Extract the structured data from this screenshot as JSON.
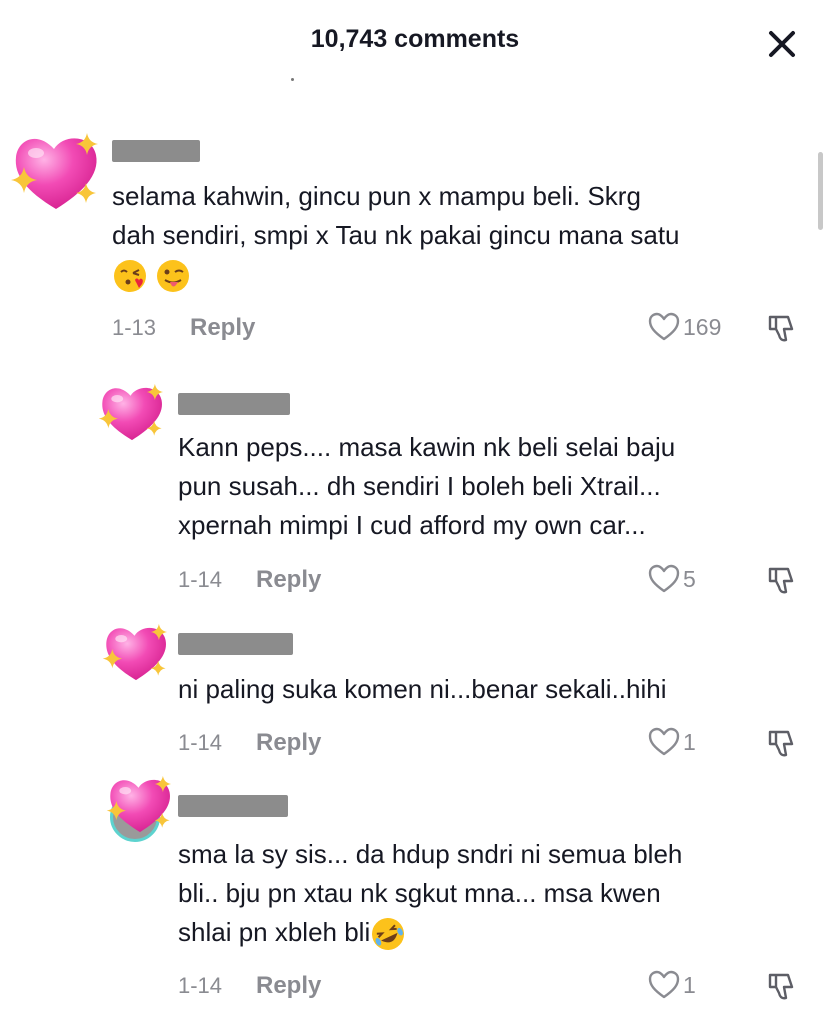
{
  "header": {
    "title": "10,743 comments"
  },
  "comments": [
    {
      "line1": "selama kahwin, gincu pun x mampu beli. Skrg",
      "line2": "dah sendiri, smpi x Tau nk pakai gincu mana satu",
      "date": "1-13",
      "reply_label": "Reply",
      "likes": "169",
      "emojis": [
        "face-blowing-kiss-emoji",
        "winking-face-tongue-emoji"
      ]
    },
    {
      "line1": "Kann peps.... masa kawin nk beli selai baju",
      "line2": "pun susah... dh sendiri I boleh beli Xtrail...",
      "line3": "xpernah mimpi I cud afford my own car...",
      "date": "1-14",
      "reply_label": "Reply",
      "likes": "5"
    },
    {
      "line1": "ni paling suka komen ni...benar sekali..hihi",
      "date": "1-14",
      "reply_label": "Reply",
      "likes": "1"
    },
    {
      "line1": "sma la sy sis... da hdup sndri ni semua bleh",
      "line2": "bli.. bju pn xtau nk sgkut mna... msa kwen",
      "line3": "shlai pn xbleh bli",
      "date": "1-14",
      "reply_label": "Reply",
      "likes": "1",
      "emojis": [
        "rolling-on-floor-laughing-emoji"
      ]
    }
  ],
  "colors": {
    "heart": "#f24bb5",
    "ring": "#5dd3cf",
    "sparkle": "#f8c53a"
  }
}
